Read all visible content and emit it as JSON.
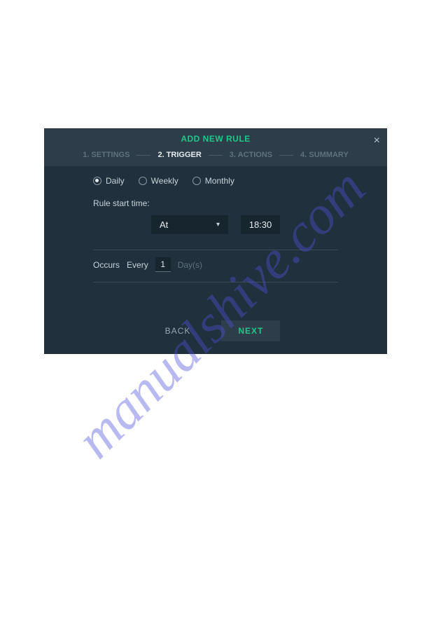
{
  "watermark": "manualshive.com",
  "modal": {
    "title": "ADD NEW RULE",
    "close": "×",
    "steps": {
      "s1": "1. SETTINGS",
      "s2": "2. TRIGGER",
      "s3": "3. ACTIONS",
      "s4": "4. SUMMARY"
    },
    "frequency": {
      "daily": "Daily",
      "weekly": "Weekly",
      "monthly": "Monthly",
      "selected": "daily"
    },
    "start_label": "Rule start time:",
    "when_select": "At",
    "time_value": "18:30",
    "occurs_label": "Occurs",
    "every_label": "Every",
    "every_value": "1",
    "days_label": "Day(s)",
    "back": "BACK",
    "next": "NEXT"
  }
}
